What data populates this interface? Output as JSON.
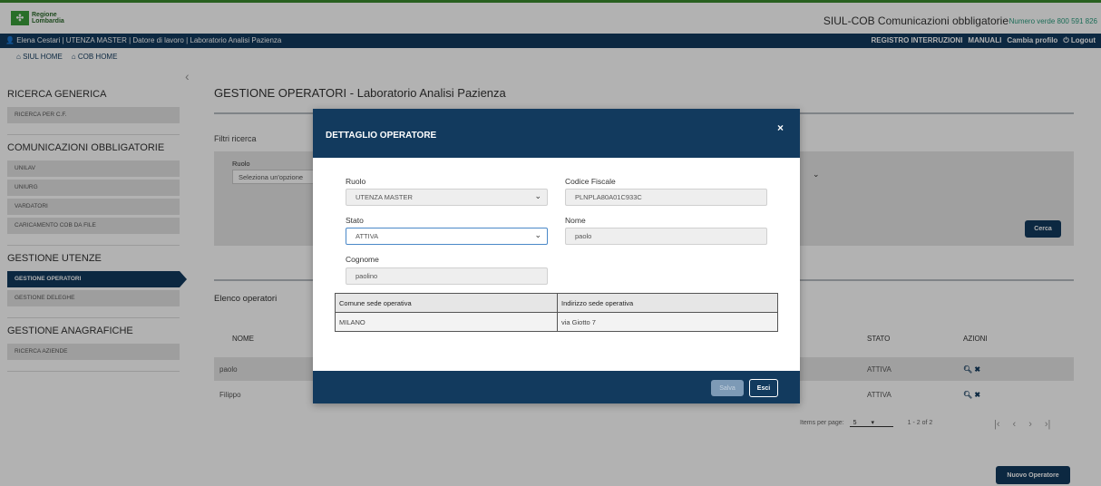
{
  "header": {
    "logo_line1": "Regione",
    "logo_line2": "Lombardia",
    "app_title": "SIUL-COB Comunicazioni obbligatorie",
    "phone": "Numero verde 800 591 826"
  },
  "userbar": {
    "user_info": "Elena Cestari | UTENZA MASTER | Datore di lavoro | Laboratorio Analisi Pazienza",
    "links": [
      "REGISTRO INTERRUZIONI",
      "MANUALI",
      "Cambia profilo",
      "Logout"
    ]
  },
  "homebar": {
    "siul_home": "SIUL HOME",
    "cob_home": "COB HOME"
  },
  "sidebar": {
    "sections": [
      {
        "title": "RICERCA GENERICA",
        "items": [
          "RICERCA PER C.F."
        ]
      },
      {
        "title": "COMUNICAZIONI OBBLIGATORIE",
        "items": [
          "UNILAV",
          "UNIURG",
          "VARDATORI",
          "CARICAMENTO COB DA FILE"
        ]
      },
      {
        "title": "GESTIONE UTENZE",
        "items": [
          "GESTIONE OPERATORI",
          "GESTIONE DELEGHE"
        ]
      },
      {
        "title": "GESTIONE ANAGRAFICHE",
        "items": [
          "RICERCA AZIENDE"
        ]
      }
    ],
    "active_item": "GESTIONE OPERATORI"
  },
  "main": {
    "title": "GESTIONE OPERATORI - Laboratorio Analisi Pazienza",
    "filter_label": "Filtri ricerca",
    "ruolo_label": "Ruolo",
    "ruolo_placeholder": "Seleziona un'opzione",
    "cerca_label": "Cerca",
    "elenco_label": "Elenco operatori",
    "columns": {
      "nome": "NOME",
      "stato": "STATO",
      "azioni": "AZIONI"
    },
    "rows": [
      {
        "nome": "paolo",
        "stato": "ATTIVA"
      },
      {
        "nome": "Filippo",
        "stato": "ATTIVA"
      }
    ],
    "items_per_page_label": "Items per page:",
    "items_per_page": "5",
    "range": "1 - 2 of 2",
    "nuovo_label": "Nuovo Operatore"
  },
  "modal": {
    "title": "DETTAGLIO OPERATORE",
    "close": "×",
    "ruolo_label": "Ruolo",
    "ruolo_value": "UTENZA MASTER",
    "cf_label": "Codice Fiscale",
    "cf_value": "PLNPLA80A01C933C",
    "stato_label": "Stato",
    "stato_value": "ATTIVA",
    "nome_label": "Nome",
    "nome_value": "paolo",
    "cognome_label": "Cognome",
    "cognome_value": "paolino",
    "table_headers": [
      "Comune sede operativa",
      "Indirizzo sede operativa"
    ],
    "table_row": [
      "MILANO",
      "via Giotto 7"
    ],
    "salva_label": "Salva",
    "esci_label": "Esci"
  }
}
